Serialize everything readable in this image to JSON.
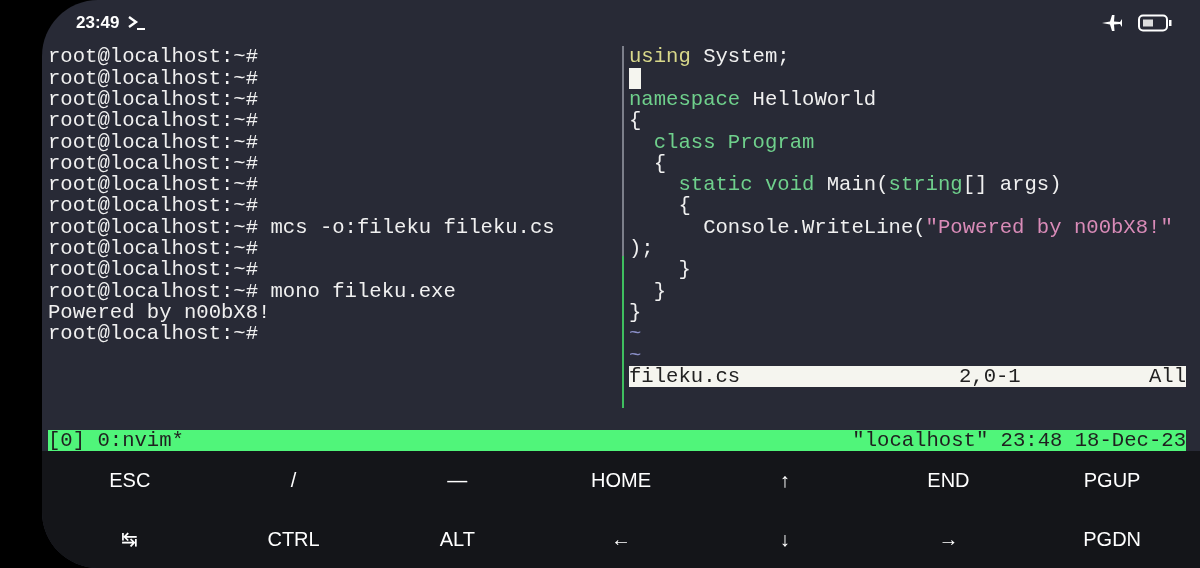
{
  "status_bar": {
    "time": "23:49"
  },
  "left_pane": {
    "lines": [
      "root@localhost:~#",
      "root@localhost:~#",
      "root@localhost:~#",
      "root@localhost:~#",
      "root@localhost:~#",
      "root@localhost:~#",
      "root@localhost:~#",
      "root@localhost:~#",
      "root@localhost:~# mcs -o:fileku fileku.cs",
      "root@localhost:~#",
      "root@localhost:~#",
      "root@localhost:~# mono fileku.exe",
      "Powered by n00bX8!",
      "root@localhost:~#"
    ]
  },
  "editor": {
    "lines": [
      {
        "cursor": false,
        "tokens": [
          {
            "text": "using",
            "kind": "preproc"
          },
          {
            "text": " System;",
            "kind": "plain"
          }
        ]
      },
      {
        "cursor": true
      },
      {
        "cursor": false,
        "tokens": [
          {
            "text": "namespace",
            "kind": "keyword"
          },
          {
            "text": " HelloWorld",
            "kind": "plain"
          }
        ]
      },
      {
        "cursor": false,
        "tokens": [
          {
            "text": "{",
            "kind": "plain"
          }
        ]
      },
      {
        "cursor": false,
        "tokens": [
          {
            "text": "  class Program",
            "kind": "keyword"
          }
        ]
      },
      {
        "cursor": false,
        "tokens": [
          {
            "text": "  {",
            "kind": "plain"
          }
        ]
      },
      {
        "cursor": false,
        "tokens": [
          {
            "text": "    static void",
            "kind": "keyword"
          },
          {
            "text": " Main(",
            "kind": "plain"
          },
          {
            "text": "string",
            "kind": "keyword"
          },
          {
            "text": "[] args)",
            "kind": "plain"
          }
        ]
      },
      {
        "cursor": false,
        "tokens": [
          {
            "text": "    {",
            "kind": "plain"
          }
        ]
      },
      {
        "cursor": false,
        "tokens": [
          {
            "text": "      Console.WriteLine(",
            "kind": "plain"
          },
          {
            "text": "\"Powered by n00bX8!\"",
            "kind": "string"
          }
        ]
      },
      {
        "cursor": false,
        "tokens": [
          {
            "text": ");",
            "kind": "plain"
          }
        ]
      },
      {
        "cursor": false,
        "tokens": [
          {
            "text": "    }",
            "kind": "plain"
          }
        ]
      },
      {
        "cursor": false,
        "tokens": [
          {
            "text": "  }",
            "kind": "plain"
          }
        ]
      },
      {
        "cursor": false,
        "tokens": [
          {
            "text": "}",
            "kind": "plain"
          }
        ]
      },
      {
        "cursor": false,
        "tokens": [
          {
            "text": "~",
            "kind": "filler"
          }
        ]
      },
      {
        "cursor": false,
        "tokens": [
          {
            "text": "~",
            "kind": "filler"
          }
        ]
      }
    ],
    "status_line": {
      "file": "fileku.cs",
      "position": "2,0-1",
      "scroll": "All"
    }
  },
  "tmux_bar": {
    "window": "[0] 0:nvim*",
    "status": "\"localhost\" 23:48 18-Dec-23"
  },
  "extra_keys": [
    [
      "ESC",
      "/",
      "—",
      "HOME",
      "↑",
      "END",
      "PGUP"
    ],
    [
      "↹",
      "CTRL",
      "ALT",
      "←",
      "↓",
      "→",
      "PGDN"
    ]
  ]
}
